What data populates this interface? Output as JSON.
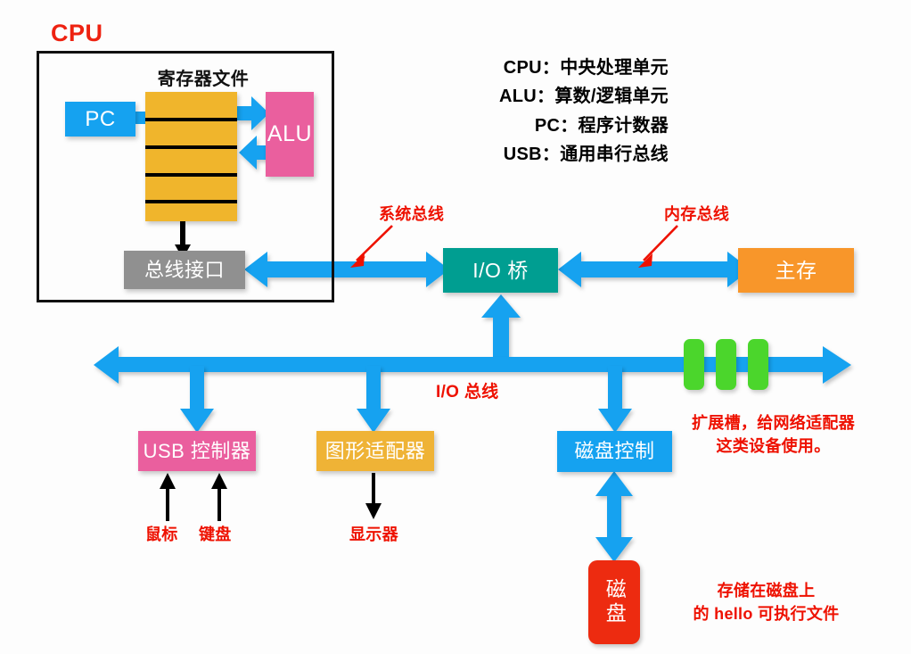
{
  "diagram": {
    "title_cpu": "CPU",
    "regfile_title": "寄存器文件",
    "nodes": {
      "pc": "PC",
      "alu": "ALU",
      "bus_interface": "总线接口",
      "io_bridge": "I/O 桥",
      "main_memory": "主存",
      "usb_controller": "USB 控制器",
      "graphics_adapter": "图形适配器",
      "disk_controller": "磁盘控制",
      "disk": "磁盘"
    },
    "bus_labels": {
      "system_bus": "系统总线",
      "memory_bus": "内存总线",
      "io_bus": "I/O 总线"
    },
    "device_labels": {
      "mouse": "鼠标",
      "keyboard": "键盘",
      "display": "显示器"
    },
    "annotations": {
      "expansion_slots_line1": "扩展槽，给网络适配器",
      "expansion_slots_line2": "这类设备使用。",
      "disk_note_line1": "存储在磁盘上",
      "disk_note_line2": "的 hello 可执行文件"
    },
    "legend": [
      {
        "term": "CPU：",
        "desc": "中央处理单元"
      },
      {
        "term": "ALU：",
        "desc": "算数/逻辑单元"
      },
      {
        "term": "PC：",
        "desc": "程序计数器"
      },
      {
        "term": "USB：",
        "desc": "通用串行总线"
      }
    ],
    "colors": {
      "bus_blue": "#15a2f0",
      "annotation_red": "#ee1100",
      "register_amber": "#f0b52c",
      "alu_pink": "#ea5f9e",
      "bus_interface_gray": "#909090",
      "io_bridge_teal": "#009e91",
      "main_memory_orange": "#f8962a",
      "graphics_amber": "#efb336",
      "disk_red": "#ed2b10",
      "expansion_green": "#4bd62c"
    }
  }
}
